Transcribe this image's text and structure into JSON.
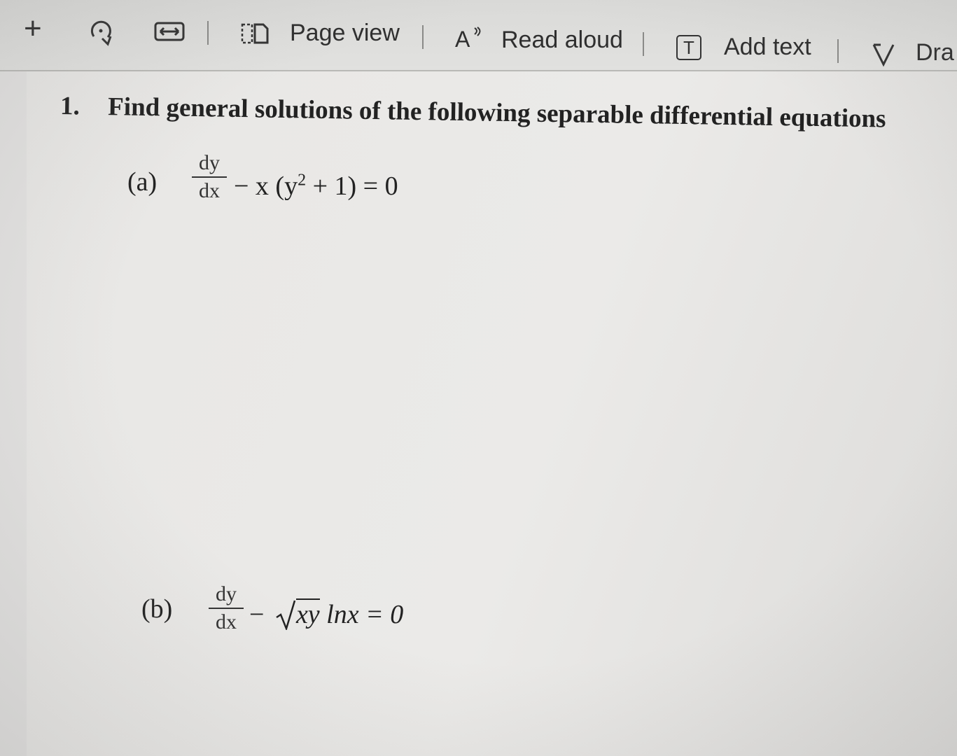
{
  "toolbar": {
    "plus_glyph": "+",
    "page_view_label": "Page view",
    "read_aloud_icon_text": "A",
    "read_aloud_label": "Read aloud",
    "add_text_icon_text": "T",
    "add_text_label": "Add text",
    "draw_label": "Dra"
  },
  "document": {
    "question_number": "1.",
    "question_text": "Find general solutions of the following separable differential equations",
    "parts": [
      {
        "label": "(a)",
        "numerator": "dy",
        "denominator": "dx",
        "rest_1": "− x (y",
        "exponent": "2",
        "rest_2": " + 1) = 0"
      },
      {
        "label": "(b)",
        "numerator": "dy",
        "denominator": "dx",
        "minus": "−",
        "radicand": "xy",
        "rest": " lnx = 0"
      }
    ]
  }
}
